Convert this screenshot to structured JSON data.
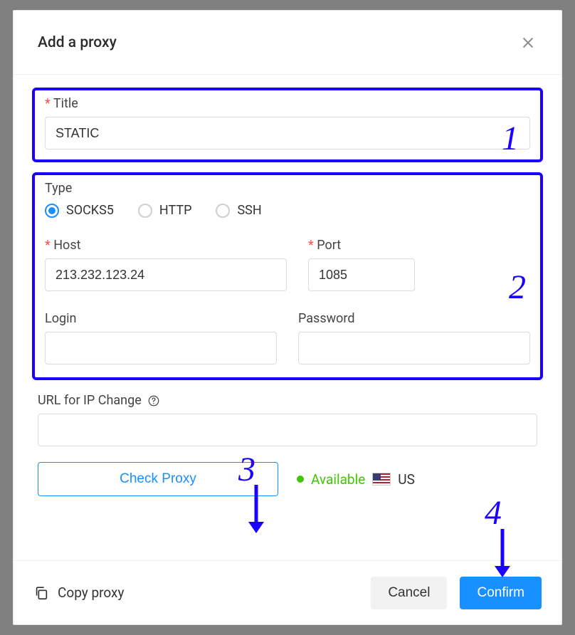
{
  "header": {
    "title": "Add a proxy"
  },
  "title_section": {
    "label": "Title",
    "value": "STATIC"
  },
  "type_section": {
    "label": "Type",
    "options": {
      "socks5": "SOCKS5",
      "http": "HTTP",
      "ssh": "SSH"
    },
    "selected": "SOCKS5",
    "host_label": "Host",
    "host_value": "213.232.123.24",
    "port_label": "Port",
    "port_value": "1085",
    "login_label": "Login",
    "login_value": "",
    "password_label": "Password",
    "password_value": ""
  },
  "url_change": {
    "label": "URL for IP Change",
    "value": ""
  },
  "check": {
    "button": "Check Proxy",
    "status": "Available",
    "country": "US"
  },
  "footer": {
    "copy": "Copy proxy",
    "cancel": "Cancel",
    "confirm": "Confirm"
  },
  "annotations": {
    "n1": "1",
    "n2": "2",
    "n3": "3",
    "n4": "4"
  },
  "colors": {
    "highlight": "#1a00ff",
    "primary": "#1890ff",
    "success": "#3ec800",
    "required": "#ff4d4f"
  }
}
